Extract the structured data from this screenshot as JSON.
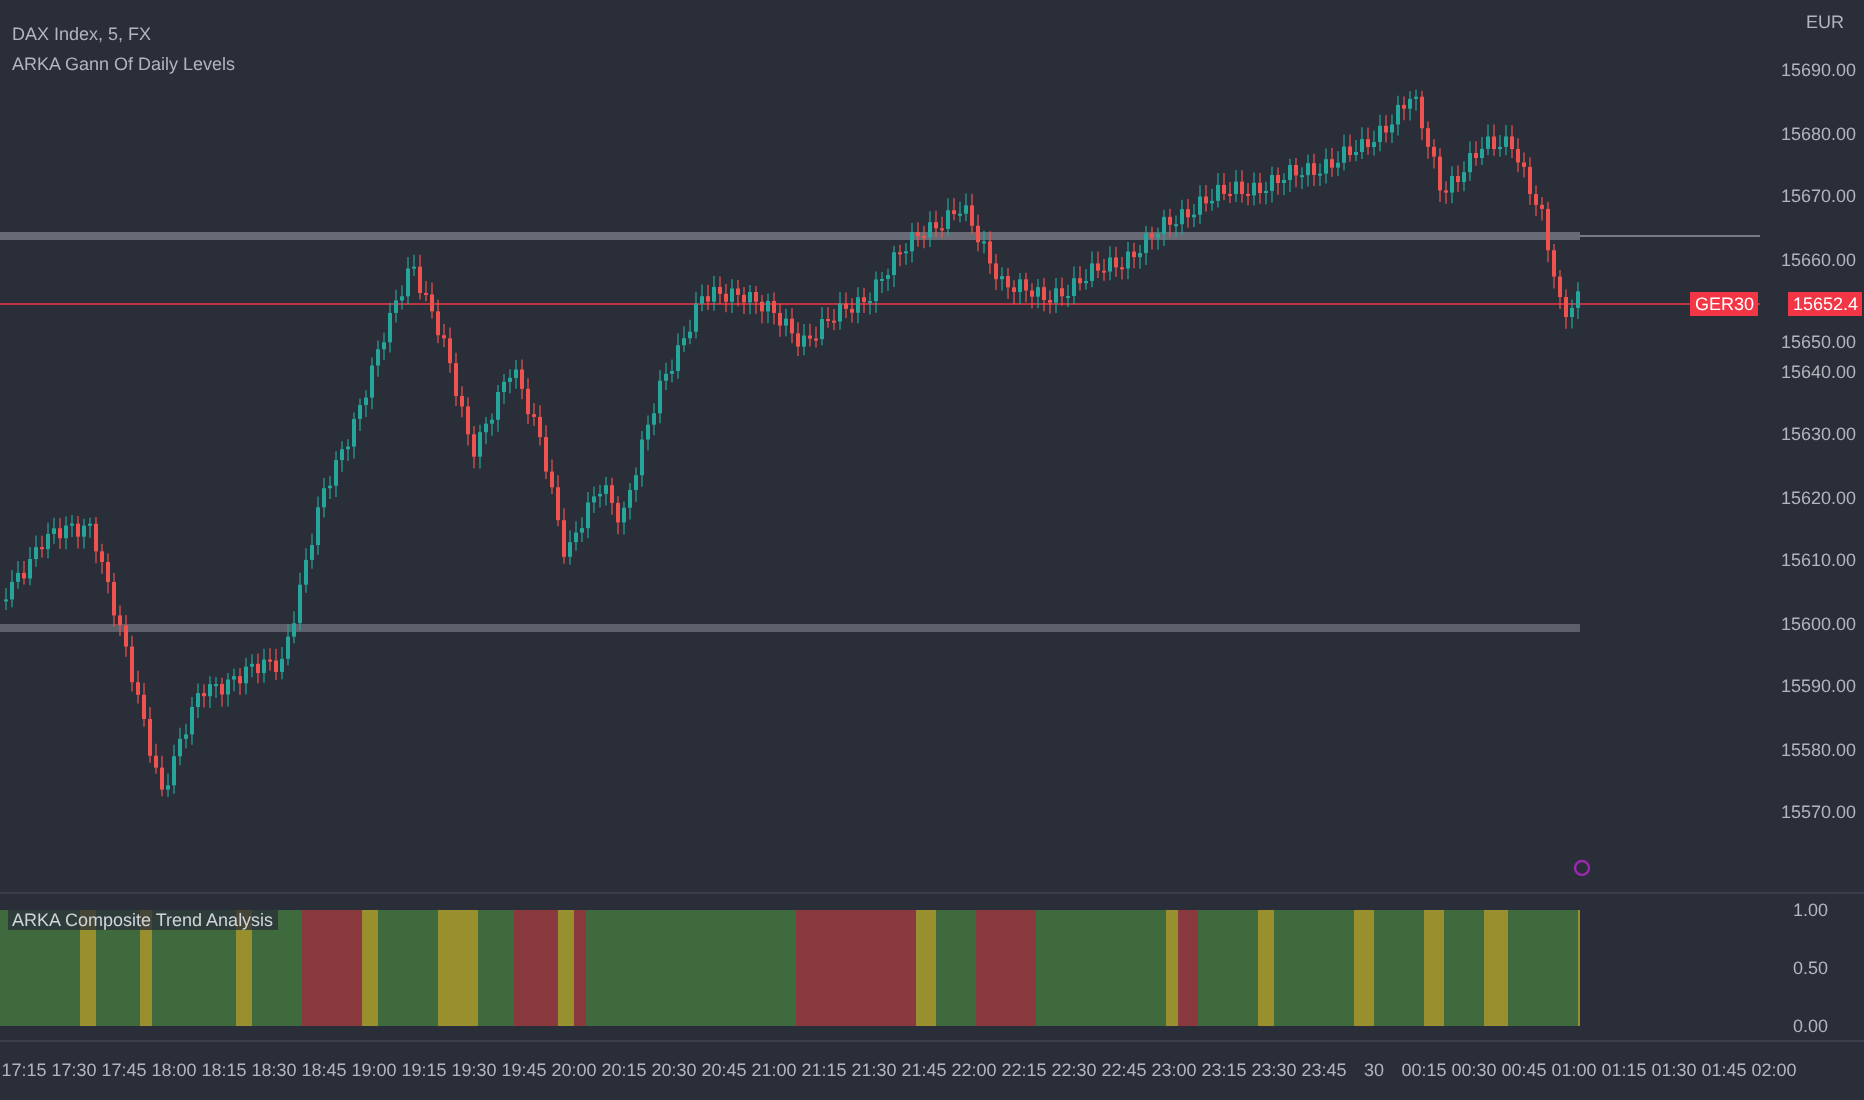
{
  "legend": {
    "symbol": "DAX Index, 5, FX",
    "study": "ARKA Gann Of Daily Levels"
  },
  "currency": "EUR",
  "price_axis": [
    "15690.00",
    "15680.00",
    "15670.00",
    "15660.00",
    "15650.00",
    "15640.00",
    "15630.00",
    "15620.00",
    "15610.00",
    "15600.00",
    "15590.00",
    "15580.00",
    "15570.00"
  ],
  "last_price": {
    "tag": "GER30",
    "value": "15652.4"
  },
  "indicator": {
    "title": "ARKA Composite Trend Analysis",
    "axis": [
      "1.00",
      "0.50",
      "0.00"
    ]
  },
  "time_axis": [
    "17:15",
    "17:30",
    "17:45",
    "18:00",
    "18:15",
    "18:30",
    "18:45",
    "19:00",
    "19:15",
    "19:30",
    "19:45",
    "20:00",
    "20:15",
    "20:30",
    "20:45",
    "21:00",
    "21:15",
    "21:30",
    "21:45",
    "22:00",
    "22:15",
    "22:30",
    "22:45",
    "23:00",
    "23:15",
    "23:30",
    "23:45",
    "30",
    "00:15",
    "00:30",
    "00:45",
    "01:00",
    "01:15",
    "01:30",
    "01:45",
    "02:00"
  ]
}
